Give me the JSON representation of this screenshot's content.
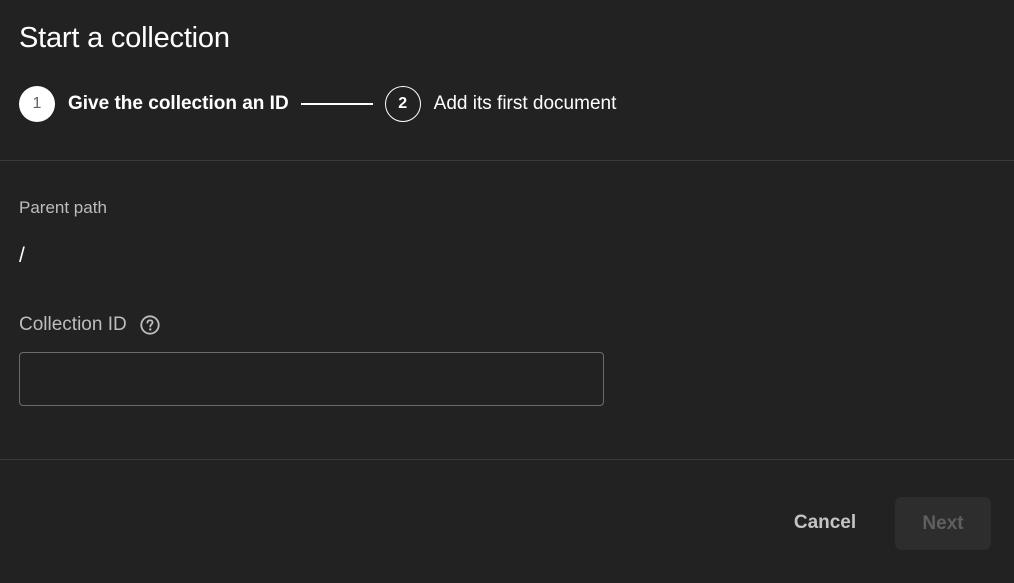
{
  "dialog": {
    "title": "Start a collection",
    "stepper": {
      "steps": [
        {
          "number": "1",
          "label": "Give the collection an ID",
          "state": "active"
        },
        {
          "number": "2",
          "label": "Add its first document",
          "state": "inactive"
        }
      ]
    },
    "parent_path": {
      "label": "Parent path",
      "value": "/"
    },
    "collection_id": {
      "label": "Collection ID",
      "value": "",
      "placeholder": "",
      "help_icon": "help-circle-icon"
    },
    "actions": {
      "cancel_label": "Cancel",
      "next_label": "Next",
      "next_enabled": false
    }
  },
  "colors": {
    "background": "#222222",
    "text_primary": "#ffffff",
    "text_secondary": "#bdbdbd",
    "divider": "#3a3a3a",
    "disabled_button_bg": "#2d2d2d",
    "disabled_button_text": "#5f5f5f"
  }
}
